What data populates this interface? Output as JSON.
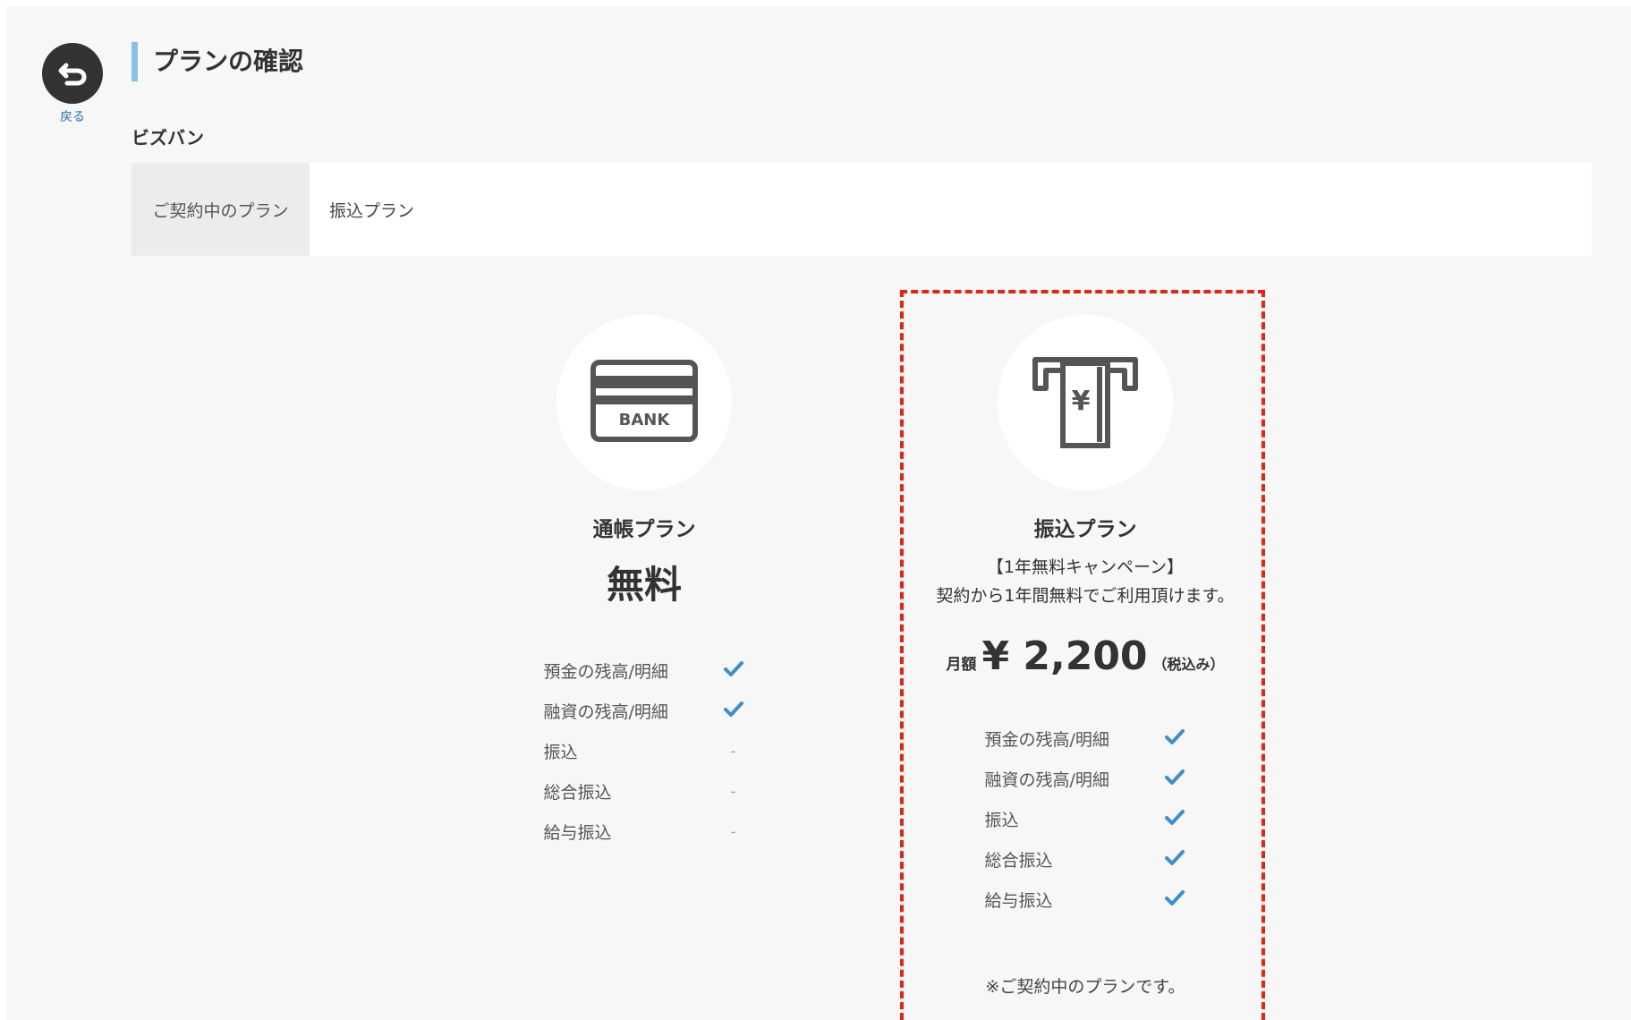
{
  "back": {
    "label": "戻る"
  },
  "header": {
    "title": "プランの確認"
  },
  "company": {
    "name": "ビズバン"
  },
  "contract": {
    "header": "ご契約中のプラン",
    "value": "振込プラン"
  },
  "plans": [
    {
      "icon": "bank-passbook-icon",
      "icon_text": "BANK",
      "name": "通帳プラン",
      "price": "無料",
      "features": [
        {
          "label": "預金の残高/明細",
          "mark": "✓"
        },
        {
          "label": "融資の残高/明細",
          "mark": "✓"
        },
        {
          "label": "振込",
          "mark": "-"
        },
        {
          "label": "総合振込",
          "mark": "-"
        },
        {
          "label": "給与振込",
          "mark": "-"
        }
      ]
    },
    {
      "icon": "atm-transfer-icon",
      "icon_text": "¥",
      "name": "振込プラン",
      "campaign_line1": "【1年無料キャンペーン】",
      "campaign_line2": "契約から1年間無料でご利用頂けます。",
      "price_prefix": "月額",
      "price_amount": "¥ 2,200",
      "price_suffix": "（税込み）",
      "features": [
        {
          "label": "預金の残高/明細",
          "mark": "✓"
        },
        {
          "label": "融資の残高/明細",
          "mark": "✓"
        },
        {
          "label": "振込",
          "mark": "✓"
        },
        {
          "label": "総合振込",
          "mark": "✓"
        },
        {
          "label": "給与振込",
          "mark": "✓"
        }
      ],
      "note": "※ご契約中のプランです。"
    }
  ],
  "colors": {
    "accent": "#86c3e6",
    "check": "#3a8fd0",
    "highlight": "#e8230f",
    "background": "#f7f7f7"
  }
}
